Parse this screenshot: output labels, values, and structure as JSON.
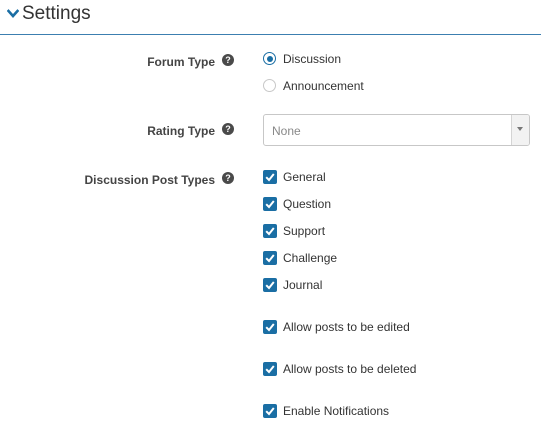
{
  "section": {
    "title": "Settings",
    "toggle_icon": "chevron-down-icon"
  },
  "forum_type": {
    "label": "Forum Type",
    "help_icon": "question-circle-icon",
    "help_glyph": "?",
    "options": [
      {
        "label": "Discussion",
        "selected": true
      },
      {
        "label": "Announcement",
        "selected": false
      }
    ]
  },
  "rating_type": {
    "label": "Rating Type",
    "help_icon": "question-circle-icon",
    "help_glyph": "?",
    "selected_value": "None",
    "arrow_icon": "caret-down-icon"
  },
  "discussion_post_types": {
    "label": "Discussion Post Types",
    "help_icon": "question-circle-icon",
    "help_glyph": "?",
    "options": [
      {
        "label": "General",
        "checked": true
      },
      {
        "label": "Question",
        "checked": true
      },
      {
        "label": "Support",
        "checked": true
      },
      {
        "label": "Challenge",
        "checked": true
      },
      {
        "label": "Journal",
        "checked": true
      }
    ]
  },
  "options": [
    {
      "label": "Allow posts to be edited",
      "checked": true
    },
    {
      "label": "Allow posts to be deleted",
      "checked": true
    },
    {
      "label": "Enable Notifications",
      "checked": true
    }
  ],
  "colors": {
    "accent": "#1a6ea4",
    "header_rule": "#3c7fb0",
    "help_icon_bg": "#4a4a4a"
  }
}
